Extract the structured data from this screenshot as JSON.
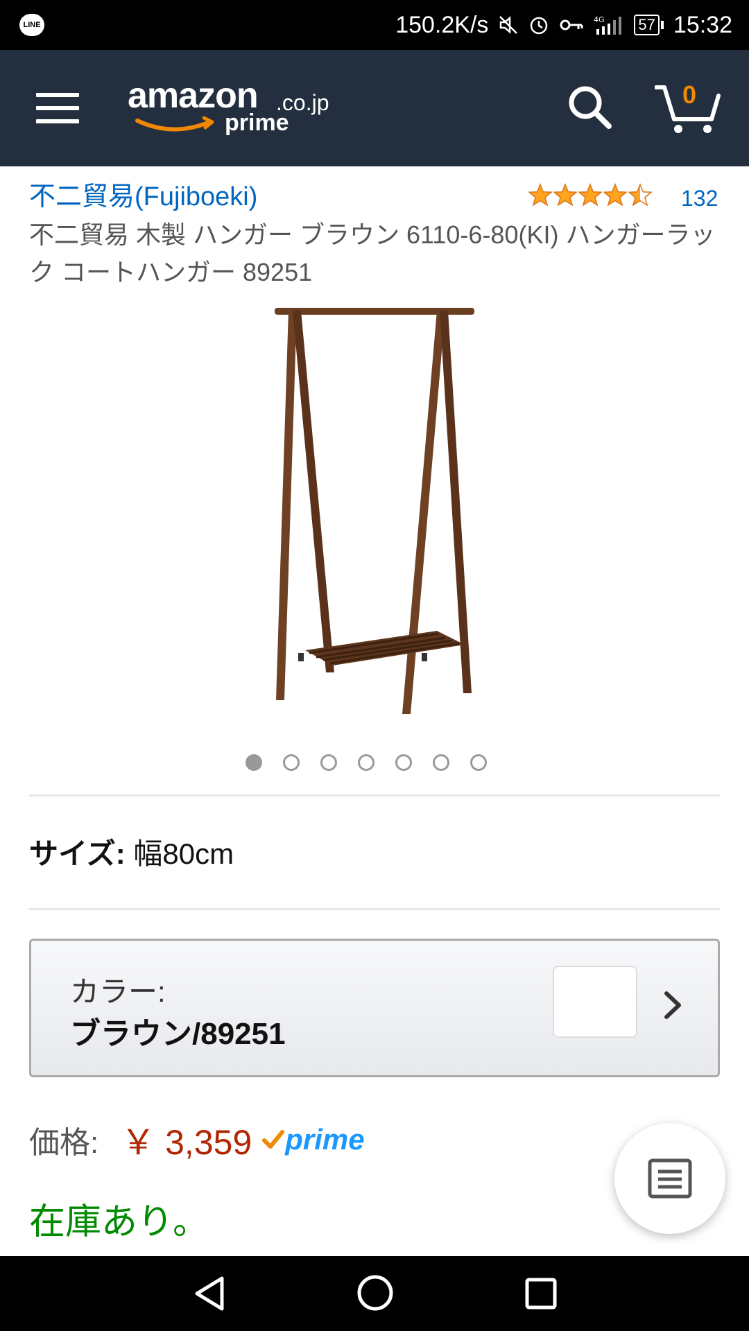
{
  "status_bar": {
    "speed": "150.2K/s",
    "battery": "57",
    "time": "15:32",
    "app_icon": "LINE",
    "network": "4G"
  },
  "header": {
    "logo_main": "amazon",
    "logo_domain": ".co.jp",
    "logo_sub": "prime",
    "cart_count": "0"
  },
  "product": {
    "brand": "不二貿易(Fujiboeki)",
    "rating_stars": 4.5,
    "rating_count": "132",
    "title": "不二貿易 木製 ハンガー ブラウン 6110-6-80(KI) ハンガーラック コートハンガー 89251",
    "image_count": 7,
    "active_image_index": 0
  },
  "size": {
    "label": "サイズ:",
    "value": "幅80cm"
  },
  "color": {
    "label": "カラー:",
    "value": "ブラウン/89251"
  },
  "price": {
    "label": "価格:",
    "value": "￥ 3,359",
    "prime": "prime"
  },
  "stock": "在庫あり。",
  "colors": {
    "header_bg": "#232f3e",
    "link": "#0066c0",
    "price": "#b12704",
    "stock": "#008a00",
    "cart_count": "#f08804",
    "star": "#ffa41c"
  }
}
